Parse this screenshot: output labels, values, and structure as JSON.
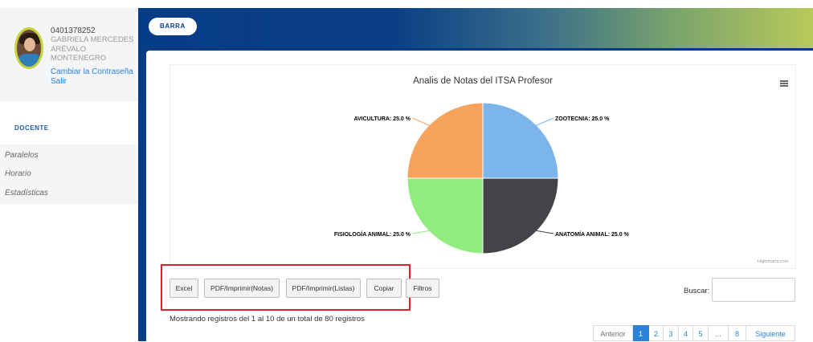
{
  "user": {
    "id": "0401378252",
    "name_lines": [
      "GABRIELA MERCEDES",
      "ARÉVALO",
      "MONTENEGRO"
    ],
    "change_password_link": "Cambiar la Contraseña",
    "logout_link": "Salir"
  },
  "sidebar": {
    "section_title": "DOCENTE",
    "items": [
      {
        "label": "Paralelos"
      },
      {
        "label": "Horario"
      },
      {
        "label": "Estadísticas"
      }
    ]
  },
  "topbar": {
    "button_label": "BARRA"
  },
  "chart": {
    "menu_icon": "hamburger-icon",
    "credit": "Highcharts.com"
  },
  "chart_data": {
    "type": "pie",
    "title": "Analis de Notas del ITSA Profesor",
    "slices": [
      {
        "name": "ZOOTECNIA",
        "value": 25.0,
        "label": "ZOOTECNIA: 25.0 %",
        "color": "#7cb5ec"
      },
      {
        "name": "ANATOMÍA ANIMAL",
        "value": 25.0,
        "label": "ANATOMÍA ANIMAL: 25.0 %",
        "color": "#434348"
      },
      {
        "name": "FISIOLOGÍA ANIMAL",
        "value": 25.0,
        "label": "FISIOLOGÍA ANIMAL: 25.0 %",
        "color": "#90ed7d"
      },
      {
        "name": "AVICULTURA",
        "value": 25.0,
        "label": "AVICULTURA: 25.0 %",
        "color": "#f7a35c"
      }
    ]
  },
  "toolbar": {
    "buttons": [
      {
        "label": "Excel"
      },
      {
        "label": "PDF/Imprimir(Notas)"
      },
      {
        "label": "PDF/Imprimir(Listas)"
      },
      {
        "label": "Copiar"
      },
      {
        "label": "Filtros"
      }
    ],
    "search_label": "Buscar:",
    "search_value": ""
  },
  "table_info": "Mostrando registros del 1 al 10 de un total de 80 registros",
  "pagination": {
    "previous": "Anterior",
    "pages": [
      "1",
      "2",
      "3",
      "4",
      "5",
      "...",
      "8"
    ],
    "next": "Siguiente",
    "active_page": "1"
  },
  "colors": {
    "primary": "#073c87",
    "link": "#2a83d8",
    "highlight_box": "#e0212a"
  }
}
